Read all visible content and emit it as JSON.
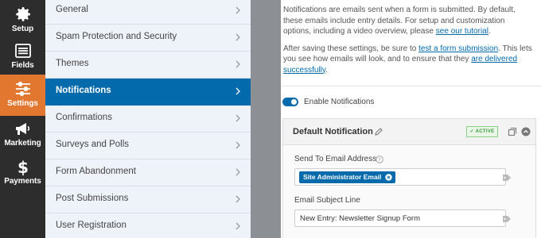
{
  "rail": {
    "items": [
      {
        "label": "Setup",
        "icon": "gear-icon"
      },
      {
        "label": "Fields",
        "icon": "list-icon"
      },
      {
        "label": "Settings",
        "icon": "sliders-icon",
        "active": true
      },
      {
        "label": "Marketing",
        "icon": "megaphone-icon"
      },
      {
        "label": "Payments",
        "icon": "dollar-icon"
      }
    ]
  },
  "sections": {
    "items": [
      {
        "label": "General"
      },
      {
        "label": "Spam Protection and Security"
      },
      {
        "label": "Themes"
      },
      {
        "label": "Notifications",
        "active": true
      },
      {
        "label": "Confirmations"
      },
      {
        "label": "Surveys and Polls"
      },
      {
        "label": "Form Abandonment"
      },
      {
        "label": "Post Submissions"
      },
      {
        "label": "User Registration"
      }
    ]
  },
  "intro": {
    "p1_text": "Notifications are emails sent when a form is submitted. By default, these emails include entry details. For setup and customization options, including a video overview, please ",
    "p1_link": "see our tutorial",
    "p1_end": ".",
    "p2_a": "After saving these settings, be sure to ",
    "p2_link1": "test a form submission",
    "p2_b": ". This lets you see how emails will look, and to ensure that they ",
    "p2_link2": "are delivered successfully",
    "p2_end": "."
  },
  "toggle": {
    "label": "Enable Notifications",
    "on": true
  },
  "notification": {
    "title": "Default Notification",
    "badge": "✓ ACTIVE",
    "send_to_label": "Send To Email Address",
    "send_to_chip": "Site Administrator Email",
    "subject_label": "Email Subject Line",
    "subject_value": "New Entry: Newsletter Signup Form"
  },
  "colors": {
    "rail_bg": "#2d2d2d",
    "rail_active": "#e27730",
    "accent_blue": "#036aab",
    "active_badge_green": "#3a9b3a"
  }
}
